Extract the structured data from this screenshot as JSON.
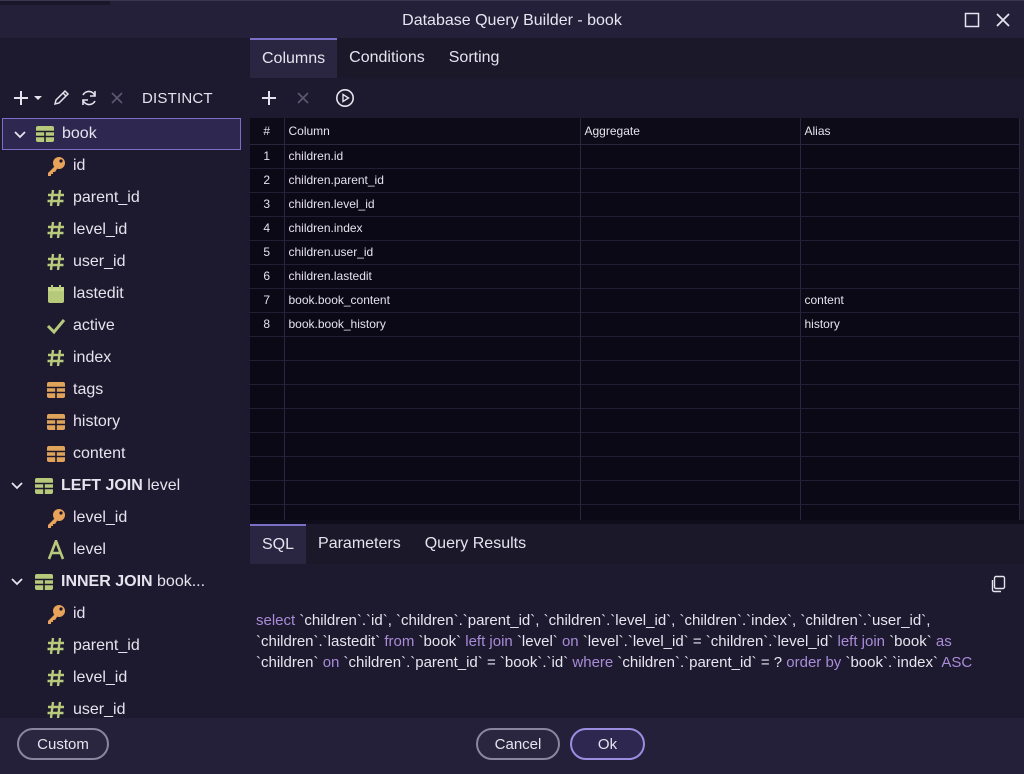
{
  "window": {
    "title": "Database Query Builder - book",
    "maximize_icon": "maximize-icon",
    "close_icon": "close-icon"
  },
  "colors": {
    "accent": "#7a6fc6",
    "keyword": "#a98bd8",
    "key_icon": "#e7a45a",
    "hash_icon": "#b7c97a",
    "table_icon": "#e0a35a"
  },
  "tree_toolbar": {
    "add_icon": "plus-icon",
    "dropdown_icon": "caret-down-icon",
    "edit_icon": "pencil-icon",
    "refresh_icon": "refresh-icon",
    "remove_icon": "close-icon",
    "distinct_label": "DISTINCT"
  },
  "tree": {
    "groups": [
      {
        "label": "book",
        "selected": true,
        "items": [
          {
            "label": "id",
            "icon": "key-icon"
          },
          {
            "label": "parent_id",
            "icon": "hash-icon"
          },
          {
            "label": "level_id",
            "icon": "hash-icon"
          },
          {
            "label": "user_id",
            "icon": "hash-icon"
          },
          {
            "label": "lastedit",
            "icon": "calendar-icon"
          },
          {
            "label": "active",
            "icon": "check-icon"
          },
          {
            "label": "index",
            "icon": "hash-icon"
          },
          {
            "label": "tags",
            "icon": "table-icon"
          },
          {
            "label": "history",
            "icon": "table-icon"
          },
          {
            "label": "content",
            "icon": "table-icon"
          }
        ]
      },
      {
        "prefix": "LEFT JOIN",
        "label": "level",
        "items": [
          {
            "label": "level_id",
            "icon": "key-icon"
          },
          {
            "label": "level",
            "icon": "text-icon"
          }
        ]
      },
      {
        "prefix": "INNER JOIN",
        "label": "book...",
        "items": [
          {
            "label": "id",
            "icon": "key-icon"
          },
          {
            "label": "parent_id",
            "icon": "hash-icon"
          },
          {
            "label": "level_id",
            "icon": "hash-icon"
          },
          {
            "label": "user_id",
            "icon": "hash-icon"
          }
        ]
      }
    ]
  },
  "tabs": [
    {
      "label": "Columns",
      "active": true
    },
    {
      "label": "Conditions"
    },
    {
      "label": "Sorting"
    }
  ],
  "grid_toolbar": {
    "add_icon": "plus-icon",
    "remove_icon": "close-icon",
    "run_icon": "play-circle-icon"
  },
  "grid": {
    "headers": [
      "#",
      "Column",
      "Aggregate",
      "Alias"
    ],
    "rows": [
      {
        "num": "1",
        "column": "children.id",
        "aggregate": "",
        "alias": ""
      },
      {
        "num": "2",
        "column": "children.parent_id",
        "aggregate": "",
        "alias": ""
      },
      {
        "num": "3",
        "column": "children.level_id",
        "aggregate": "",
        "alias": ""
      },
      {
        "num": "4",
        "column": "children.index",
        "aggregate": "",
        "alias": ""
      },
      {
        "num": "5",
        "column": "children.user_id",
        "aggregate": "",
        "alias": ""
      },
      {
        "num": "6",
        "column": "children.lastedit",
        "aggregate": "",
        "alias": ""
      },
      {
        "num": "7",
        "column": "book.book_content",
        "aggregate": "",
        "alias": "content"
      },
      {
        "num": "8",
        "column": "book.book_history",
        "aggregate": "",
        "alias": "history"
      }
    ],
    "empty_rows": 8
  },
  "bottom_tabs": [
    {
      "label": "SQL",
      "active": true
    },
    {
      "label": "Parameters"
    },
    {
      "label": "Query Results"
    }
  ],
  "sql": {
    "copy_icon": "copy-icon",
    "tokens": [
      {
        "t": "select ",
        "k": true
      },
      {
        "t": "`children`.`id`, `children`.`parent_id`, `children`.`level_id`, `children`.`index`, `children`.`user_id`, `children`.`lastedit` "
      },
      {
        "t": "from ",
        "k": true
      },
      {
        "t": "`book` "
      },
      {
        "t": "left join ",
        "k": true
      },
      {
        "t": "`level` "
      },
      {
        "t": "on ",
        "k": true
      },
      {
        "t": "`level`.`level_id` = `children`.`level_id` "
      },
      {
        "t": "left join ",
        "k": true
      },
      {
        "t": "`book` "
      },
      {
        "t": "as ",
        "k": true
      },
      {
        "t": "`children` "
      },
      {
        "t": "on ",
        "k": true
      },
      {
        "t": "`children`.`parent_id` = `book`.`id` "
      },
      {
        "t": "where ",
        "k": true
      },
      {
        "t": "`children`.`parent_id` = ? "
      },
      {
        "t": "order by ",
        "k": true
      },
      {
        "t": "`book`.`index` "
      },
      {
        "t": "ASC",
        "k": true
      }
    ]
  },
  "footer": {
    "custom_label": "Custom",
    "cancel_label": "Cancel",
    "ok_label": "Ok"
  }
}
